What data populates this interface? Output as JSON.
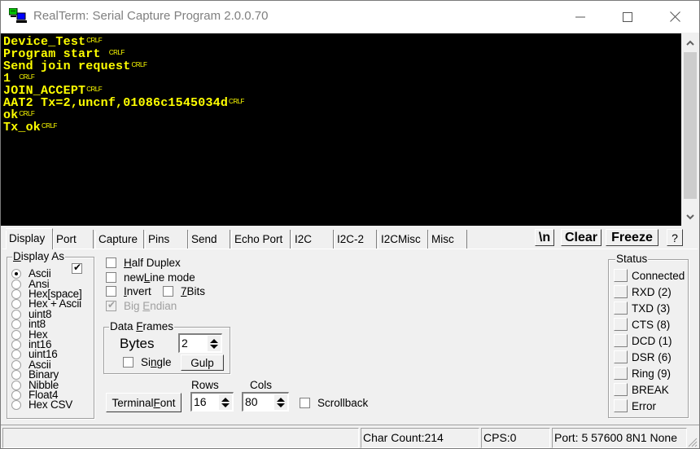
{
  "window": {
    "title": "RealTerm: Serial Capture Program 2.0.0.70",
    "app_icon": "realterm-network-icon",
    "controls": [
      "minimize-icon",
      "maximize-icon",
      "close-icon"
    ]
  },
  "terminal": {
    "text_color": "#ffff00",
    "background": "#000000",
    "eol_marker": "CRLF",
    "lines": [
      "Device_Test",
      "Program start ",
      "Send join request",
      "1 ",
      "JOIN_ACCEPT",
      "AAT2 Tx=2,uncnf,01086c1545034d",
      "ok",
      "Tx_ok"
    ]
  },
  "tabs": {
    "active": "Display",
    "items": [
      "Display",
      "Port",
      "Capture",
      "Pins",
      "Send",
      "Echo Port",
      "I2C",
      "I2C-2",
      "I2CMisc",
      "Misc"
    ]
  },
  "toolbar": {
    "newline_label": "\\n",
    "clear_label": "Clear",
    "freeze_label": "Freeze",
    "help_label": "?"
  },
  "display_as": {
    "legend": "Display As",
    "legend_ul": "D",
    "legend_rest": "isplay As",
    "enabled_checked": true,
    "selected": "Ascii",
    "options": [
      "Ascii",
      "Ansi",
      "Hex[space]",
      "Hex + Ascii",
      "uint8",
      "int8",
      "Hex",
      "int16",
      "uint16",
      "Ascii",
      "Binary",
      "Nibble",
      "Float4",
      "Hex CSV"
    ]
  },
  "options": {
    "half_duplex": {
      "ul": "H",
      "rest": "alf Duplex",
      "checked": false
    },
    "newline_mode": {
      "pre": "new",
      "ul": "L",
      "rest": "ine mode",
      "checked": false
    },
    "invert": {
      "ul": "I",
      "rest": "nvert",
      "checked": false
    },
    "seven_bits": {
      "ul": "7",
      "rest": "Bits",
      "checked": false
    },
    "big_endian": {
      "pre": "Big ",
      "ul": "E",
      "rest": "ndian",
      "checked": true,
      "disabled": true
    }
  },
  "data_frames": {
    "legend_pre": "Data ",
    "legend_ul": "F",
    "legend_rest": "rames",
    "bytes_label": "Bytes",
    "bytes_value": "2",
    "single": {
      "pre": "Si",
      "ul": "n",
      "rest": "gle",
      "checked": false
    },
    "gulp_label": "Gulp"
  },
  "terminal_settings": {
    "font_button_pre": "Terminal ",
    "font_button_ul": "F",
    "font_button_rest": "ont",
    "rows_label": "Rows",
    "rows_value": "16",
    "cols_label": "Cols",
    "cols_value": "80",
    "scrollback_label": "Scrollback",
    "scrollback_checked": false
  },
  "status": {
    "legend": "Status",
    "items": [
      "Connected",
      "RXD (2)",
      "TXD (3)",
      "CTS (8)",
      "DCD (1)",
      "DSR (6)",
      "Ring (9)",
      "BREAK",
      "Error"
    ]
  },
  "statusbar": {
    "message": "",
    "char_count": "Char Count:214",
    "cps": "CPS:0",
    "port": "Port: 5 57600 8N1 None"
  }
}
